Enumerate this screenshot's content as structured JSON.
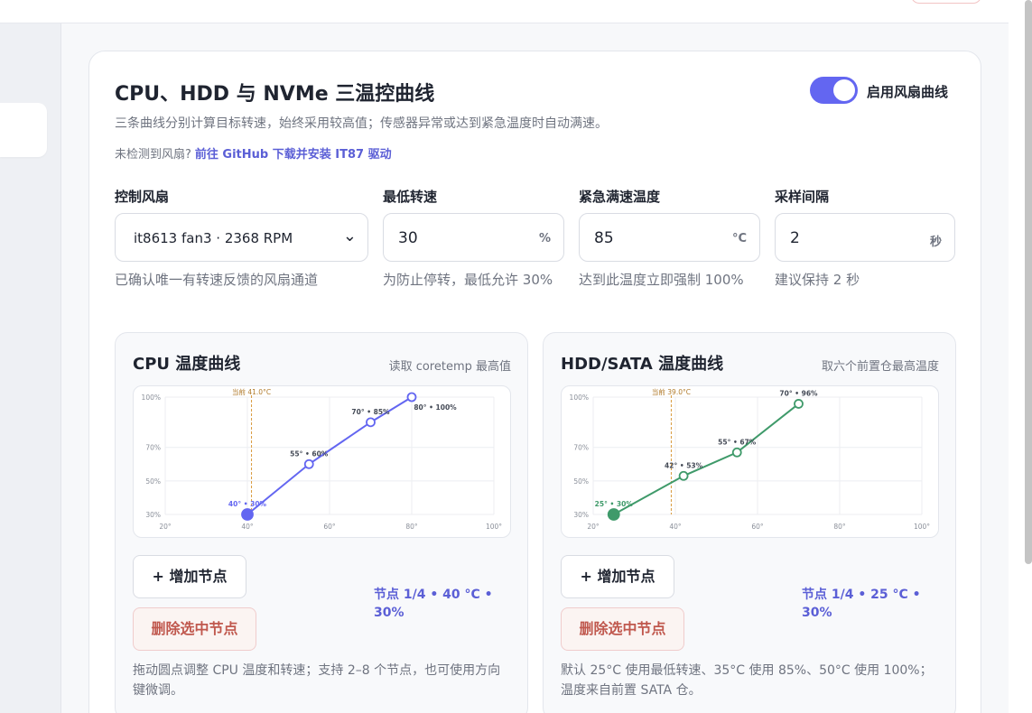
{
  "header": {
    "title": "CPU、HDD 与 NVMe 三温控曲线",
    "subtitle": "三条曲线分别计算目标转速，始终采用较高值；传感器异常或达到紧急温度时自动满速。",
    "notice_prefix": "未检测到风扇?",
    "notice_link": "前往 GitHub 下载并安装 IT87 驱动",
    "toggle_label": "启用风扇曲线",
    "toggle_on": true
  },
  "fields": {
    "fan": {
      "label": "控制风扇",
      "value": "it8613 fan3 · 2368 RPM",
      "help": "已确认唯一有转速反馈的风扇通道"
    },
    "min_speed": {
      "label": "最低转速",
      "value": "30",
      "unit": "%",
      "help": "为防止停转，最低允许 30%"
    },
    "emergency": {
      "label": "紧急满速温度",
      "value": "85",
      "unit": "°C",
      "help": "达到此温度立即强制 100%"
    },
    "interval": {
      "label": "采样间隔",
      "value": "2",
      "unit": "秒",
      "help": "建议保持 2 秒"
    }
  },
  "cpu": {
    "title": "CPU 温度曲线",
    "note": "读取 coretemp 最高值",
    "add_label": "+ 增加节点",
    "delete_label": "删除选中节点",
    "node_info": "节点 1/4 • 40 °C • 30%",
    "desc": "拖动圆点调整 CPU 温度和转速；支持 2–8 个节点，也可使用方向键微调。",
    "color": "#6366f1"
  },
  "hdd": {
    "title": "HDD/SATA 温度曲线",
    "note": "取六个前置仓最高温度",
    "add_label": "+ 增加节点",
    "delete_label": "删除选中节点",
    "node_info": "节点 1/4 • 25 °C • 30%",
    "desc": "默认 25°C 使用最低转速、35°C 使用 85%、50°C 使用 100%；温度来自前置 SATA 仓。",
    "color": "#3f9a6a"
  },
  "chart_data": [
    {
      "type": "line",
      "name": "CPU",
      "x_ticks": [
        "20°",
        "40°",
        "60°",
        "80°",
        "100°"
      ],
      "y_ticks": [
        "100%",
        "70%",
        "50%",
        "30%"
      ],
      "xlim": [
        20,
        100
      ],
      "ylim": [
        30,
        100
      ],
      "current_label": "当前 41.0°C",
      "current_temp": 41.0,
      "points": [
        {
          "x": 40,
          "y": 30,
          "label": "40° • 30%"
        },
        {
          "x": 55,
          "y": 60,
          "label": "55° • 60%"
        },
        {
          "x": 70,
          "y": 85,
          "label": "70° • 85%"
        },
        {
          "x": 80,
          "y": 100,
          "label": "80° • 100%"
        }
      ],
      "selected_index": 0,
      "color": "#6366f1"
    },
    {
      "type": "line",
      "name": "HDD/SATA",
      "x_ticks": [
        "20°",
        "40°",
        "60°",
        "80°",
        "100°"
      ],
      "y_ticks": [
        "100%",
        "70%",
        "50%",
        "30%"
      ],
      "xlim": [
        20,
        100
      ],
      "ylim": [
        30,
        100
      ],
      "current_label": "当前 39.0°C",
      "current_temp": 39.0,
      "points": [
        {
          "x": 25,
          "y": 30,
          "label": "25° • 30%"
        },
        {
          "x": 42,
          "y": 53,
          "label": "42° • 53%"
        },
        {
          "x": 55,
          "y": 67,
          "label": "55° • 67%"
        },
        {
          "x": 70,
          "y": 96,
          "label": "70° • 96%"
        }
      ],
      "selected_index": 0,
      "color": "#3f9a6a"
    }
  ]
}
